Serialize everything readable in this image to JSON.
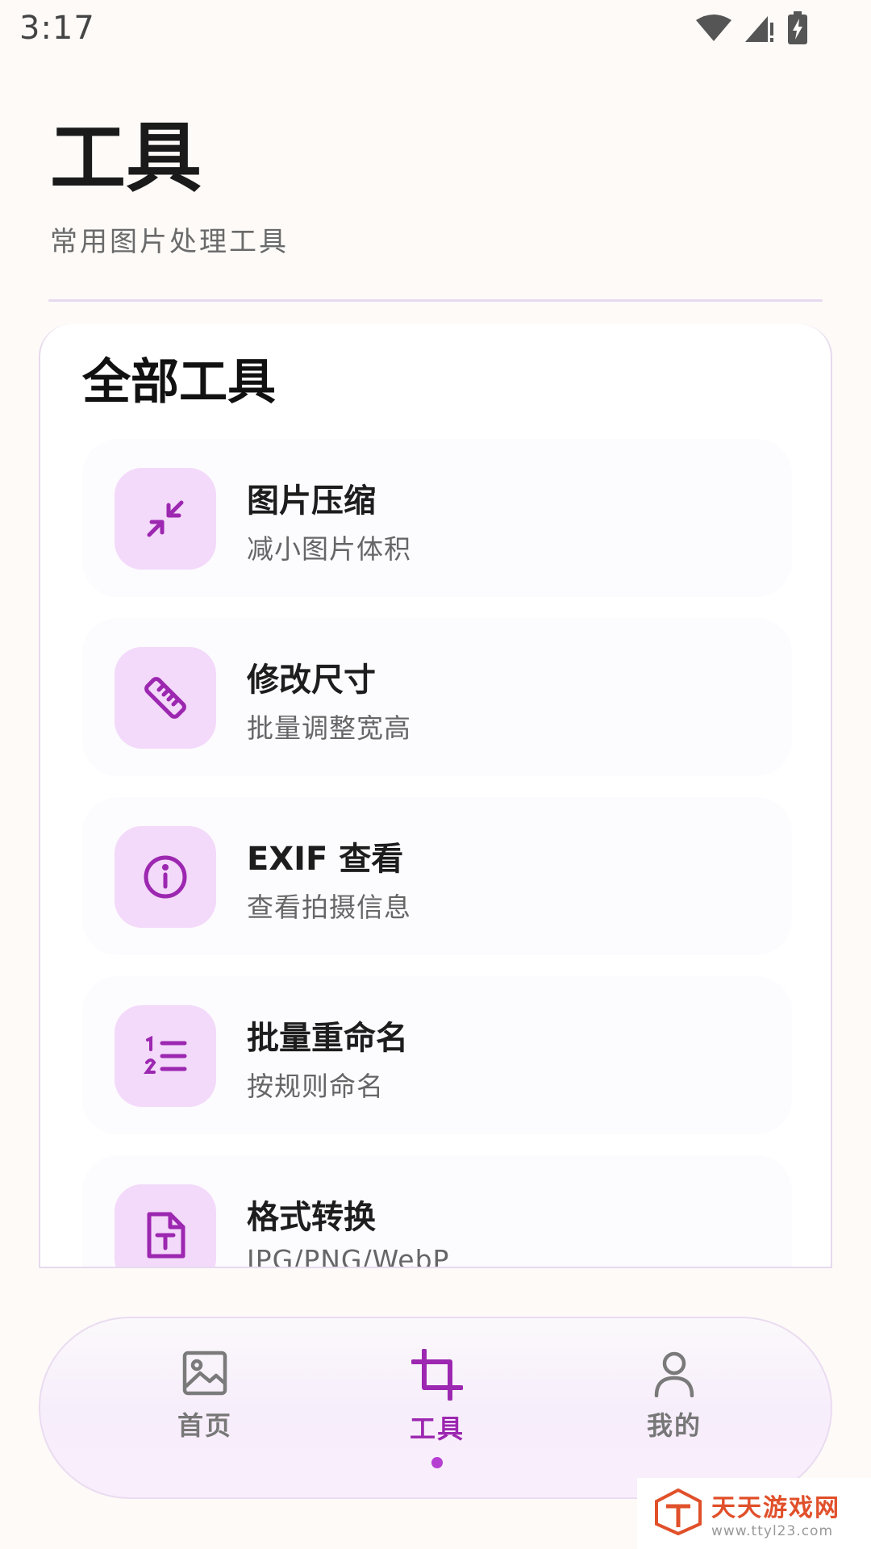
{
  "status_bar": {
    "time": "3:17",
    "icons": [
      "wifi-icon",
      "cell-signal-icon",
      "battery-charging-icon"
    ]
  },
  "header": {
    "title": "工具",
    "subtitle": "常用图片处理工具"
  },
  "card": {
    "title": "全部工具",
    "tools": [
      {
        "name": "图片压缩",
        "desc": "减小图片体积",
        "icon": "compress-icon"
      },
      {
        "name": "修改尺寸",
        "desc": "批量调整宽高",
        "icon": "ruler-icon"
      },
      {
        "name": "EXIF 查看",
        "desc": "查看拍摄信息",
        "icon": "info-icon"
      },
      {
        "name": "批量重命名",
        "desc": "按规则命名",
        "icon": "numbered-list-icon"
      },
      {
        "name": "格式转换",
        "desc": "JPG/PNG/WebP",
        "icon": "file-text-icon"
      }
    ]
  },
  "bottom_nav": {
    "items": [
      {
        "label": "首页",
        "icon": "image-icon"
      },
      {
        "label": "工具",
        "icon": "crop-icon",
        "active": true
      },
      {
        "label": "我的",
        "icon": "person-icon"
      }
    ]
  },
  "watermark": {
    "title": "天天游戏网",
    "url": "www.ttyl23.com"
  },
  "colors": {
    "accent": "#9c27b0",
    "icon_bg": "#f3d9fa",
    "background": "#fdfaf8"
  }
}
